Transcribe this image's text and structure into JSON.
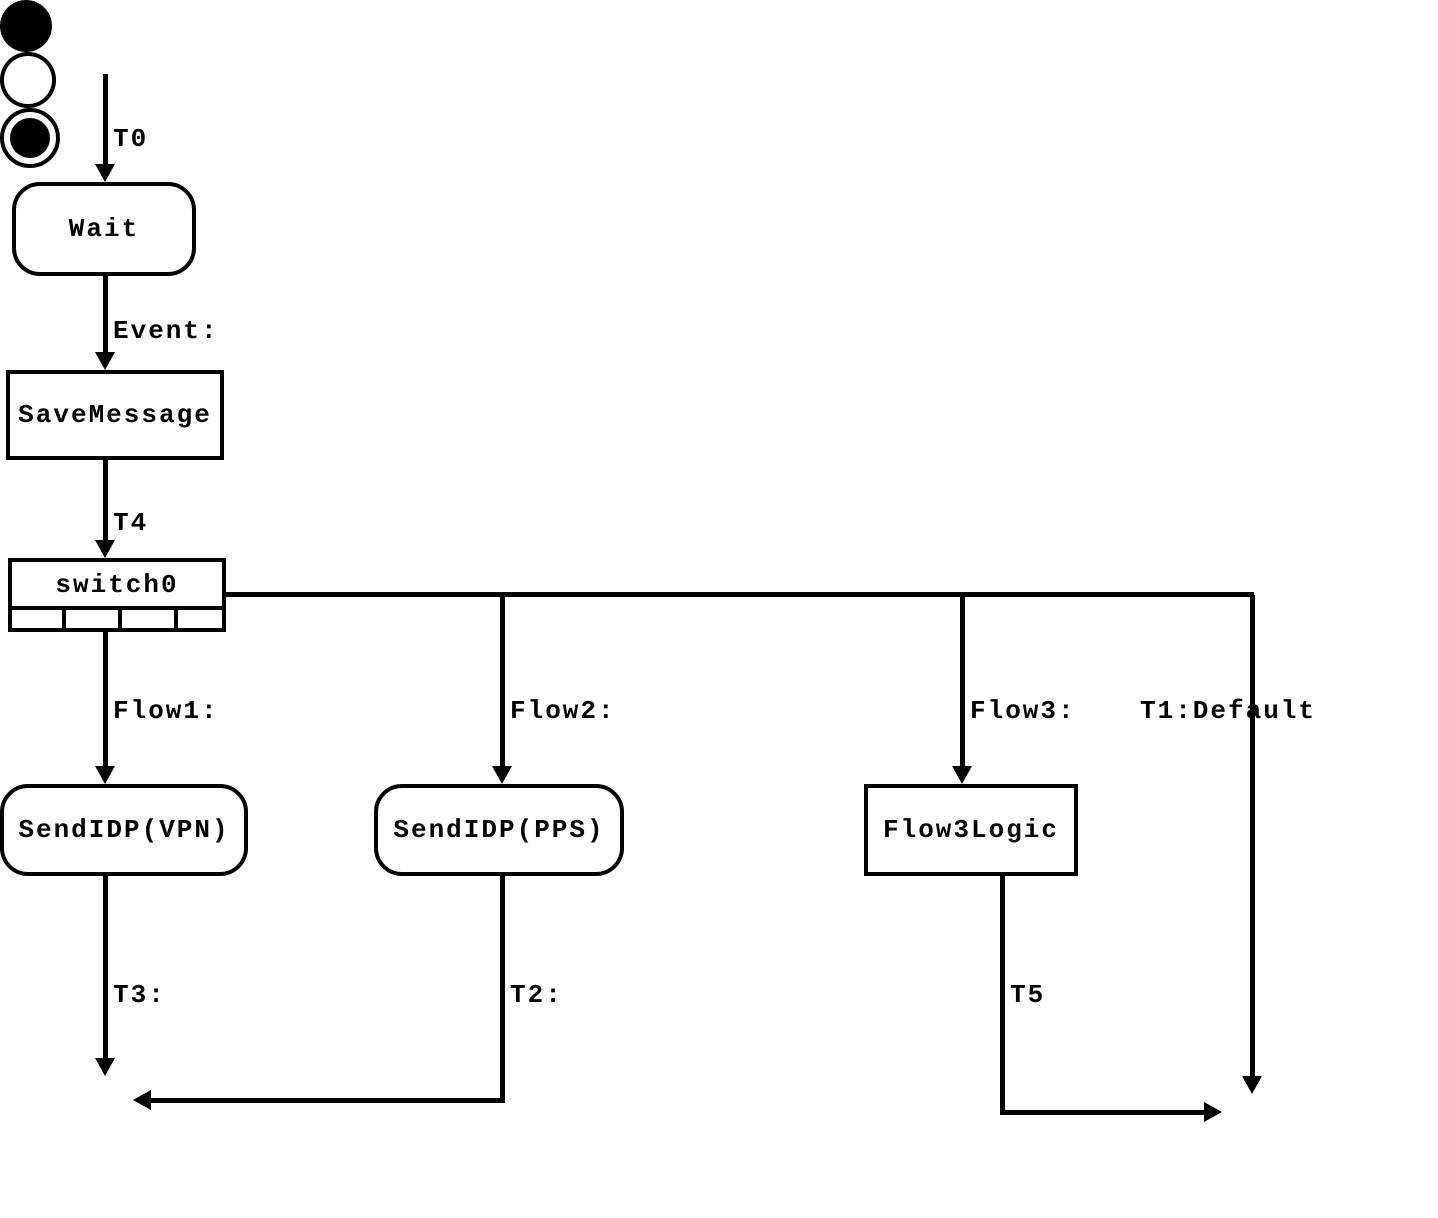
{
  "diagram": {
    "type": "uml-state-activity-diagram",
    "nodes": {
      "start": {
        "kind": "initial-state"
      },
      "wait": {
        "label": "Wait",
        "kind": "rounded"
      },
      "saveMessage": {
        "label": "SaveMessage",
        "kind": "rect"
      },
      "switch0": {
        "label": "switch0",
        "kind": "switch"
      },
      "sendIdpVpn": {
        "label": "SendIDP(VPN)",
        "kind": "rounded"
      },
      "sendIdpPps": {
        "label": "SendIDP(PPS)",
        "kind": "rounded"
      },
      "flow3Logic": {
        "label": "Flow3Logic",
        "kind": "rect"
      },
      "merge": {
        "kind": "merge-circle"
      },
      "final": {
        "kind": "final-state"
      }
    },
    "edges": {
      "t0": {
        "label": "T0",
        "from": "start",
        "to": "wait"
      },
      "event": {
        "label": "Event:",
        "from": "wait",
        "to": "saveMessage"
      },
      "t4": {
        "label": "T4",
        "from": "saveMessage",
        "to": "switch0"
      },
      "flow1": {
        "label": "Flow1:",
        "from": "switch0",
        "to": "sendIdpVpn"
      },
      "flow2": {
        "label": "Flow2:",
        "from": "switch0",
        "to": "sendIdpPps"
      },
      "flow3": {
        "label": "Flow3:",
        "from": "switch0",
        "to": "flow3Logic"
      },
      "t1": {
        "label": "T1:Default",
        "from": "switch0",
        "to": "final"
      },
      "t3": {
        "label": "T3:",
        "from": "sendIdpVpn",
        "to": "merge"
      },
      "t2": {
        "label": "T2:",
        "from": "sendIdpPps",
        "to": "merge"
      },
      "t5": {
        "label": "T5",
        "from": "flow3Logic",
        "to": "final"
      }
    }
  }
}
